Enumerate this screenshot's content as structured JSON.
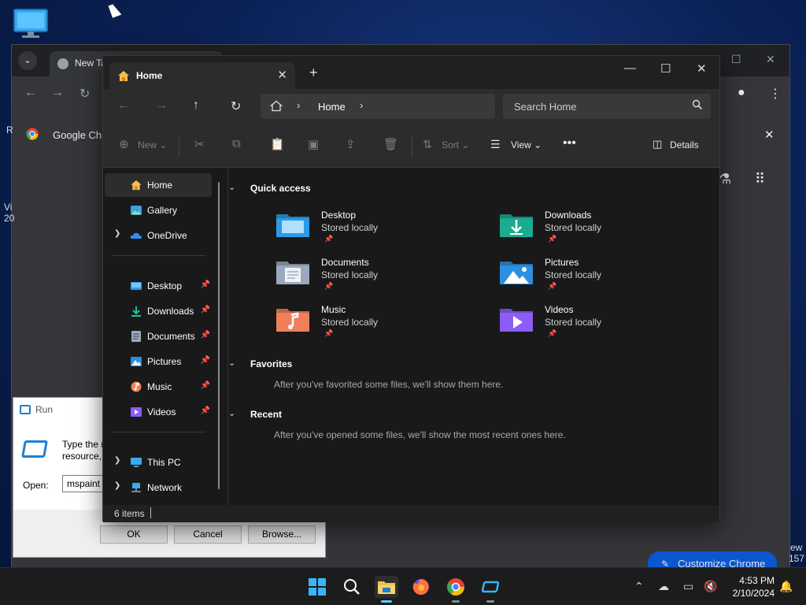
{
  "chrome": {
    "tab_title": "New Tab",
    "infobar_text": "Google Chrome",
    "customize_label": "Customize Chrome"
  },
  "desktop_fragments": {
    "left_r": "R",
    "left_vi": "Vi",
    "left_20": "20",
    "right_ew": "ew",
    "right_157": "157"
  },
  "run_dialog": {
    "title": "Run",
    "description_line1": "Type the n",
    "description_line2": "resource, ",
    "open_label": "Open:",
    "open_value": "mspaint",
    "ok_label": "OK",
    "cancel_label": "Cancel",
    "browse_label": "Browse..."
  },
  "explorer": {
    "tab_title": "Home",
    "breadcrumb": "Home",
    "search_placeholder": "Search Home",
    "toolbar": {
      "new_label": "New",
      "sort_label": "Sort",
      "view_label": "View",
      "details_label": "Details"
    },
    "nav": {
      "home": "Home",
      "gallery": "Gallery",
      "onedrive": "OneDrive",
      "desktop": "Desktop",
      "downloads": "Downloads",
      "documents": "Documents",
      "pictures": "Pictures",
      "music": "Music",
      "videos": "Videos",
      "this_pc": "This PC",
      "network": "Network"
    },
    "sections": {
      "quick_access": "Quick access",
      "favorites": "Favorites",
      "favorites_hint": "After you've favorited some files, we'll show them here.",
      "recent": "Recent",
      "recent_hint": "After you've opened some files, we'll show the most recent ones here."
    },
    "quick_access": [
      {
        "name": "Desktop",
        "sub": "Stored locally",
        "color": "#2b9be6"
      },
      {
        "name": "Downloads",
        "sub": "Stored locally",
        "color": "#1bab8f"
      },
      {
        "name": "Documents",
        "sub": "Stored locally",
        "color": "#9aa9bf"
      },
      {
        "name": "Pictures",
        "sub": "Stored locally",
        "color": "#2d8fe0"
      },
      {
        "name": "Music",
        "sub": "Stored locally",
        "color": "#f0805a"
      },
      {
        "name": "Videos",
        "sub": "Stored locally",
        "color": "#8b5cf6"
      }
    ],
    "status_count": "6 items"
  },
  "taskbar": {
    "time": "4:53 PM",
    "date": "2/10/2024"
  }
}
